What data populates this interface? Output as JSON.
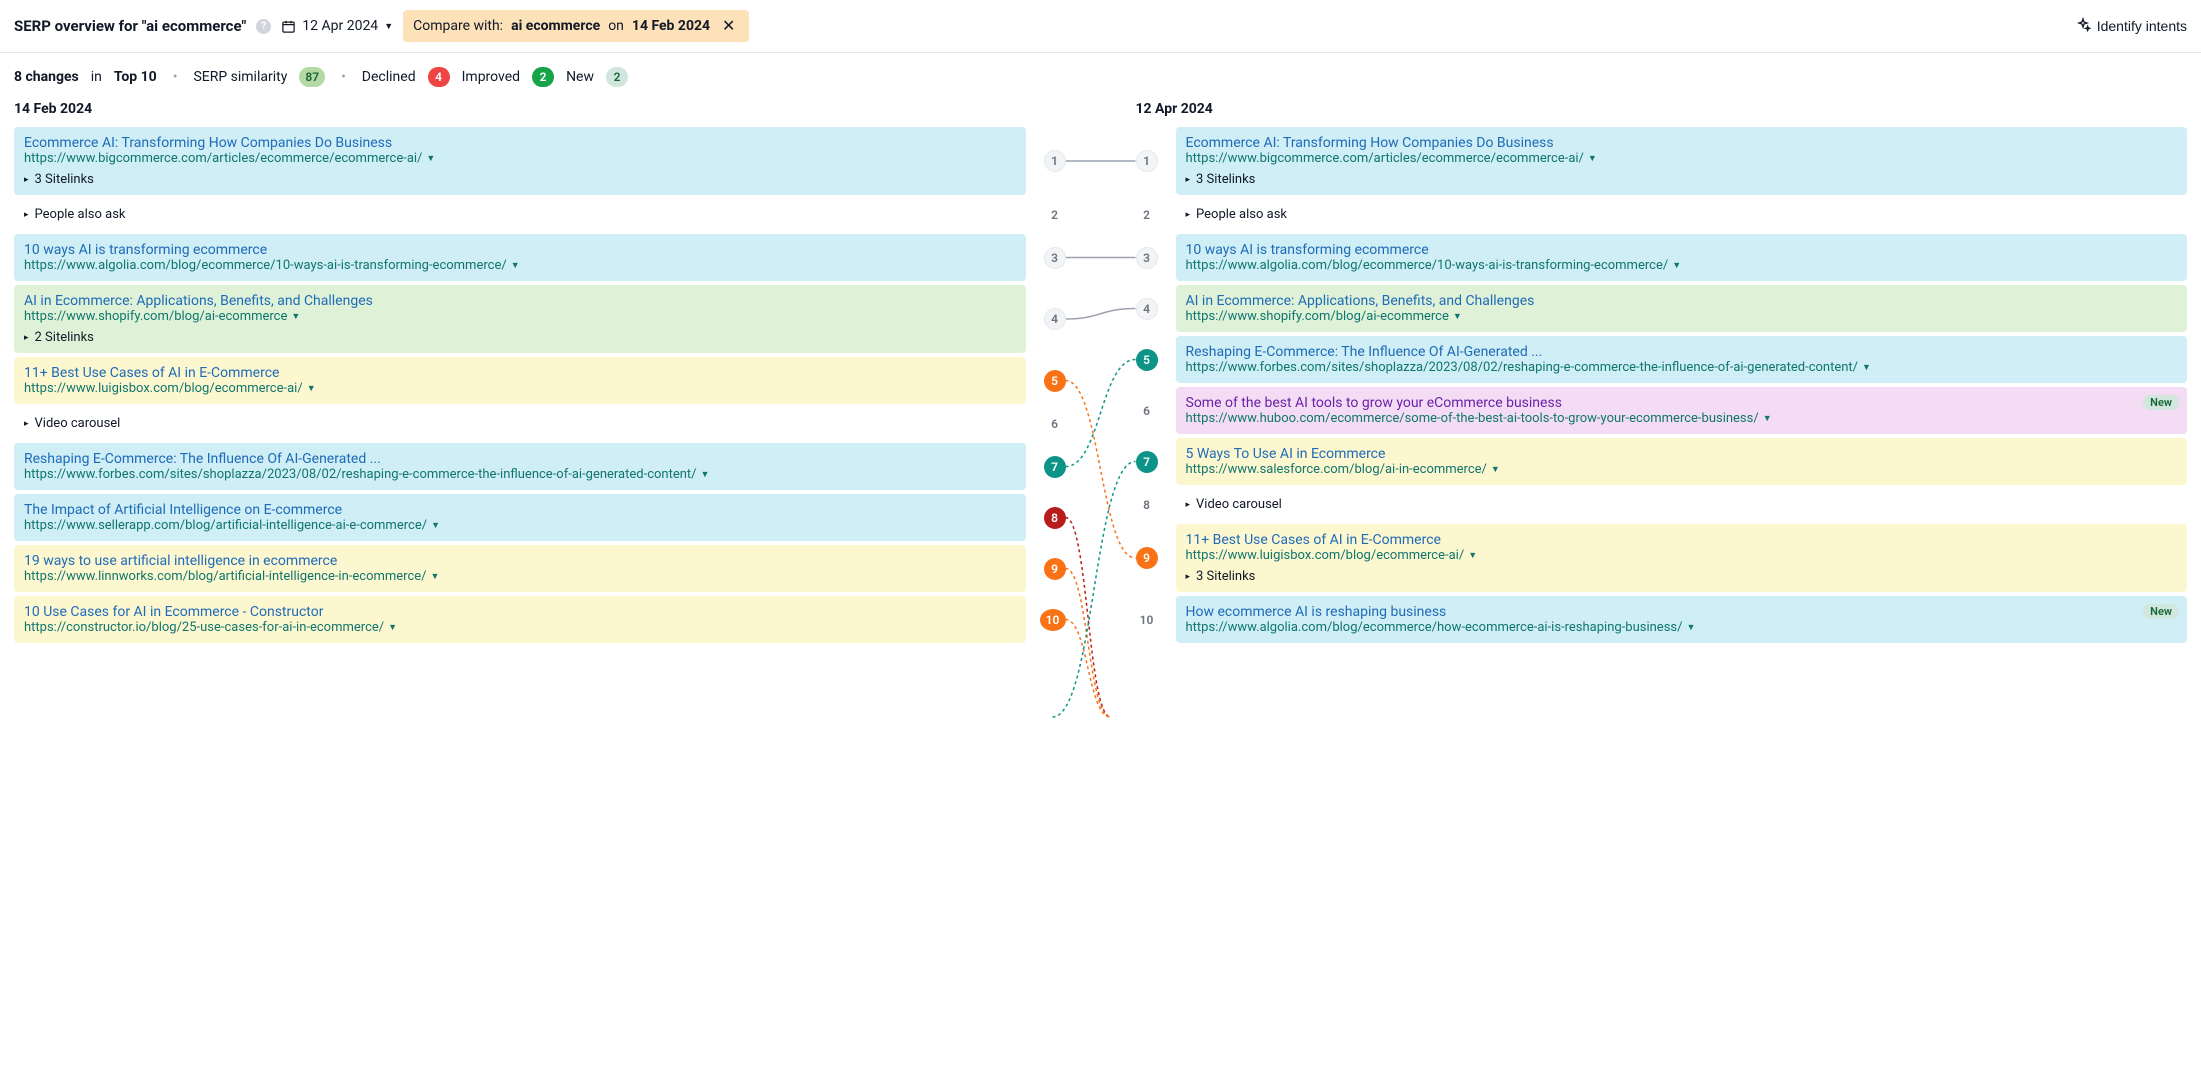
{
  "header": {
    "title": "SERP overview for \"ai ecommerce\"",
    "date": "12 Apr 2024",
    "compare_prefix": "Compare with:",
    "compare_term": "ai ecommerce",
    "compare_on": "on",
    "compare_date": "14 Feb 2024",
    "identify_label": "Identify intents"
  },
  "summary": {
    "changes_count": "8 changes",
    "changes_in": "in",
    "changes_scope": "Top 10",
    "similarity_label": "SERP similarity",
    "similarity_value": "87",
    "declined_label": "Declined",
    "declined_value": "4",
    "improved_label": "Improved",
    "improved_value": "2",
    "new_label": "New",
    "new_value": "2"
  },
  "left": {
    "date_label": "14 Feb 2024",
    "rows": [
      {
        "rank": "1",
        "rank_cls": "rb-grey",
        "bg": "bg-blue",
        "title": "Ecommerce AI: Transforming How Companies Do Business",
        "title_cls": "ttl-link",
        "url": "https://www.bigcommerce.com/articles/ecommerce/ecommerce-ai/",
        "has_dd": true,
        "extra": "3 Sitelinks"
      },
      {
        "rank": "2",
        "rank_cls": "rb-plain",
        "bg": "bg-none",
        "feature": "People also ask"
      },
      {
        "rank": "3",
        "rank_cls": "rb-grey",
        "bg": "bg-blue",
        "title": "10 ways AI is transforming ecommerce",
        "title_cls": "ttl-link",
        "url": "https://www.algolia.com/blog/ecommerce/10-ways-ai-is-transforming-ecommerce/",
        "has_dd": true
      },
      {
        "rank": "4",
        "rank_cls": "rb-grey",
        "bg": "bg-green",
        "title": "AI in Ecommerce: Applications, Benefits, and Challenges",
        "title_cls": "ttl-link",
        "url": "https://www.shopify.com/blog/ai-ecommerce",
        "has_dd": true,
        "extra": "2 Sitelinks"
      },
      {
        "rank": "5",
        "rank_cls": "rb-orange",
        "bg": "bg-yellow",
        "title": "11+ Best Use Cases of AI in E-Commerce",
        "title_cls": "ttl-link",
        "url": "https://www.luigisbox.com/blog/ecommerce-ai/",
        "has_dd": true
      },
      {
        "rank": "6",
        "rank_cls": "rb-plain",
        "bg": "bg-none",
        "feature": "Video carousel"
      },
      {
        "rank": "7",
        "rank_cls": "rb-green",
        "bg": "bg-blue",
        "title": "Reshaping E-Commerce: The Influence Of AI-Generated ...",
        "title_cls": "ttl-link",
        "url": "https://www.forbes.com/sites/shoplazza/2023/08/02/reshaping-e-commerce-the-influence-of-ai-generated-content/",
        "has_dd": true
      },
      {
        "rank": "8",
        "rank_cls": "rb-dred",
        "bg": "bg-blue",
        "title": "The Impact of Artificial Intelligence on E-commerce",
        "title_cls": "ttl-link",
        "url": "https://www.sellerapp.com/blog/artificial-intelligence-ai-e-commerce/",
        "has_dd": true
      },
      {
        "rank": "9",
        "rank_cls": "rb-orange",
        "bg": "bg-yellow",
        "title": "19 ways to use artificial intelligence in ecommerce",
        "title_cls": "ttl-link",
        "url": "https://www.linnworks.com/blog/artificial-intelligence-in-ecommerce/",
        "has_dd": true
      },
      {
        "rank": "10",
        "rank_cls": "rb-orange rb-wide",
        "bg": "bg-yellow",
        "title": "10 Use Cases for AI in Ecommerce - Constructor",
        "title_cls": "ttl-link",
        "url": "https://constructor.io/blog/25-use-cases-for-ai-in-ecommerce/",
        "has_dd": true
      }
    ]
  },
  "right": {
    "date_label": "12 Apr 2024",
    "rows": [
      {
        "rank": "1",
        "rank_cls": "rb-grey",
        "bg": "bg-blue",
        "title": "Ecommerce AI: Transforming How Companies Do Business",
        "title_cls": "ttl-link",
        "url": "https://www.bigcommerce.com/articles/ecommerce/ecommerce-ai/",
        "has_dd": true,
        "extra": "3 Sitelinks"
      },
      {
        "rank": "2",
        "rank_cls": "rb-plain",
        "bg": "bg-none",
        "feature": "People also ask"
      },
      {
        "rank": "3",
        "rank_cls": "rb-grey",
        "bg": "bg-blue",
        "title": "10 ways AI is transforming ecommerce",
        "title_cls": "ttl-link",
        "url": "https://www.algolia.com/blog/ecommerce/10-ways-ai-is-transforming-ecommerce/",
        "has_dd": true
      },
      {
        "rank": "4",
        "rank_cls": "rb-grey",
        "bg": "bg-green",
        "title": "AI in Ecommerce: Applications, Benefits, and Challenges",
        "title_cls": "ttl-link",
        "url": "https://www.shopify.com/blog/ai-ecommerce",
        "has_dd": true
      },
      {
        "rank": "5",
        "rank_cls": "rb-green",
        "bg": "bg-blue",
        "title": "Reshaping E-Commerce: The Influence Of AI-Generated ...",
        "title_cls": "ttl-link",
        "url": "https://www.forbes.com/sites/shoplazza/2023/08/02/reshaping-e-commerce-the-influence-of-ai-generated-content/",
        "has_dd": true
      },
      {
        "rank": "6",
        "rank_cls": "rb-plain",
        "bg": "bg-pink",
        "title": "Some of the best AI tools to grow your eCommerce business",
        "title_cls": "ttl-link ttl-purple",
        "url": "https://www.huboo.com/ecommerce/some-of-the-best-ai-tools-to-grow-your-ecommerce-business/",
        "has_dd": true,
        "is_new": true
      },
      {
        "rank": "7",
        "rank_cls": "rb-green",
        "bg": "bg-yellow",
        "title": "5 Ways To Use AI in Ecommerce",
        "title_cls": "ttl-link",
        "url": "https://www.salesforce.com/blog/ai-in-ecommerce/",
        "has_dd": true
      },
      {
        "rank": "8",
        "rank_cls": "rb-plain",
        "bg": "bg-none",
        "feature": "Video carousel"
      },
      {
        "rank": "9",
        "rank_cls": "rb-orange",
        "bg": "bg-yellow",
        "title": "11+ Best Use Cases of AI in E-Commerce",
        "title_cls": "ttl-link",
        "url": "https://www.luigisbox.com/blog/ecommerce-ai/",
        "has_dd": true,
        "extra": "3 Sitelinks"
      },
      {
        "rank": "10",
        "rank_cls": "rb-plain",
        "bg": "bg-blue",
        "title": "How ecommerce AI is reshaping business",
        "title_cls": "ttl-link",
        "url": "https://www.algolia.com/blog/ecommerce/how-ecommerce-ai-is-reshaping-business/",
        "has_dd": true,
        "is_new": true
      }
    ]
  },
  "new_badge_label": "New",
  "connections": [
    {
      "from": 0,
      "to": 0,
      "color": "#9ca3af",
      "dash": false
    },
    {
      "from": 2,
      "to": 2,
      "color": "#9ca3af",
      "dash": false
    },
    {
      "from": 3,
      "to": 3,
      "color": "#9ca3af",
      "dash": false
    },
    {
      "from": 4,
      "to": 8,
      "color": "#f97316",
      "dash": true
    },
    {
      "from": 6,
      "to": 4,
      "color": "#0d9488",
      "dash": true
    },
    {
      "from": 7,
      "to": 10,
      "color": "#b91c1c",
      "dash": true,
      "openEnd": true
    },
    {
      "from": 8,
      "to": 10,
      "color": "#f97316",
      "dash": true,
      "openEnd": true
    },
    {
      "from": 9,
      "to": 10,
      "color": "#f97316",
      "dash": true,
      "openEnd": true
    },
    {
      "from": -1,
      "to": 6,
      "color": "#0d9488",
      "dash": true,
      "fromBelow": true
    }
  ]
}
